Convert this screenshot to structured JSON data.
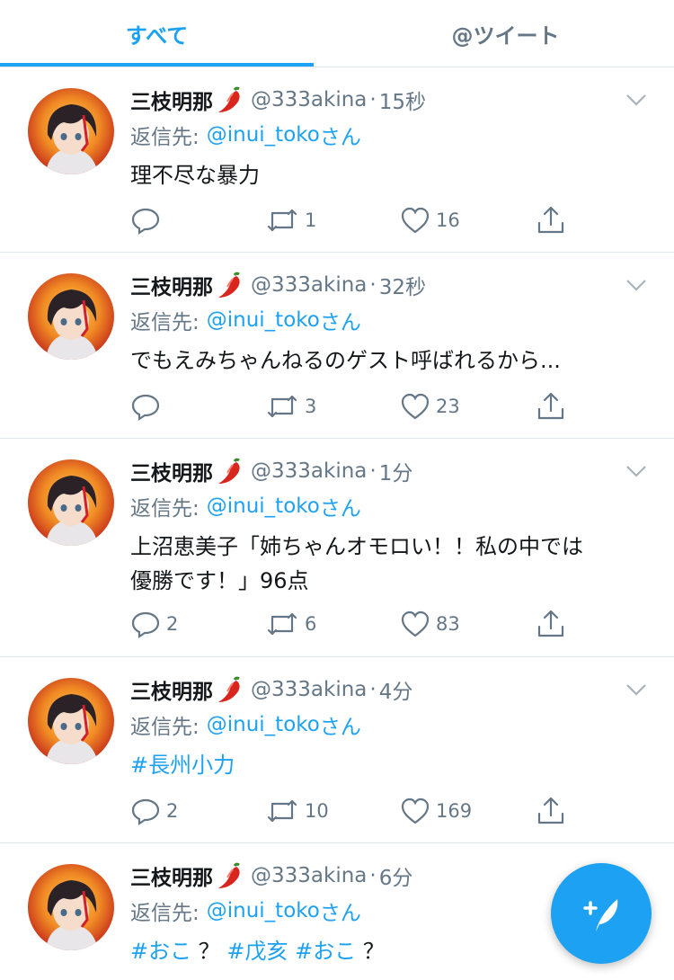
{
  "tabs": [
    {
      "label": "すべて",
      "active": true
    },
    {
      "label": "@ツイート",
      "active": false
    }
  ],
  "colors": {
    "accent": "#1da1f2",
    "muted": "#657786",
    "text": "#14171a",
    "divider": "#e1e8ed"
  },
  "tweets": [
    {
      "name": "三枝明那",
      "handle": "@333akina",
      "sep": "·",
      "time": "15秒",
      "reply_label": "返信先:",
      "reply_user": "@inui_toko",
      "reply_suffix": "さん",
      "text": "理不尽な暴力",
      "replies": "",
      "retweets": "1",
      "likes": "16"
    },
    {
      "name": "三枝明那",
      "handle": "@333akina",
      "sep": "·",
      "time": "32秒",
      "reply_label": "返信先:",
      "reply_user": "@inui_toko",
      "reply_suffix": "さん",
      "text": "でもえみちゃんねるのゲスト呼ばれるから...",
      "replies": "",
      "retweets": "3",
      "likes": "23"
    },
    {
      "name": "三枝明那",
      "handle": "@333akina",
      "sep": "·",
      "time": "1分",
      "reply_label": "返信先:",
      "reply_user": "@inui_toko",
      "reply_suffix": "さん",
      "text_line1": "上沼恵美子「姉ちゃんオモロい！！私の中では",
      "text_line2": "優勝です！」96点",
      "replies": "2",
      "retweets": "6",
      "likes": "83"
    },
    {
      "name": "三枝明那",
      "handle": "@333akina",
      "sep": "·",
      "time": "4分",
      "reply_label": "返信先:",
      "reply_user": "@inui_toko",
      "reply_suffix": "さん",
      "hashtag": "#長州小力",
      "replies": "2",
      "retweets": "10",
      "likes": "169"
    },
    {
      "name": "三枝明那",
      "handle": "@333akina",
      "sep": "·",
      "time": "6分",
      "reply_label": "返信先:",
      "reply_user": "@inui_toko",
      "reply_suffix": "さん",
      "tag1": "#おこ",
      "q1": "？",
      "tag2": "#戊亥",
      "tag3": "#おこ",
      "q2": "？"
    }
  ],
  "icons": {
    "reply": "reply-icon",
    "retweet": "retweet-icon",
    "like": "heart-icon",
    "share": "share-icon",
    "more": "chevron-down-icon",
    "compose": "compose-tweet-icon",
    "name_emoji": "chili-pepper-icon"
  }
}
